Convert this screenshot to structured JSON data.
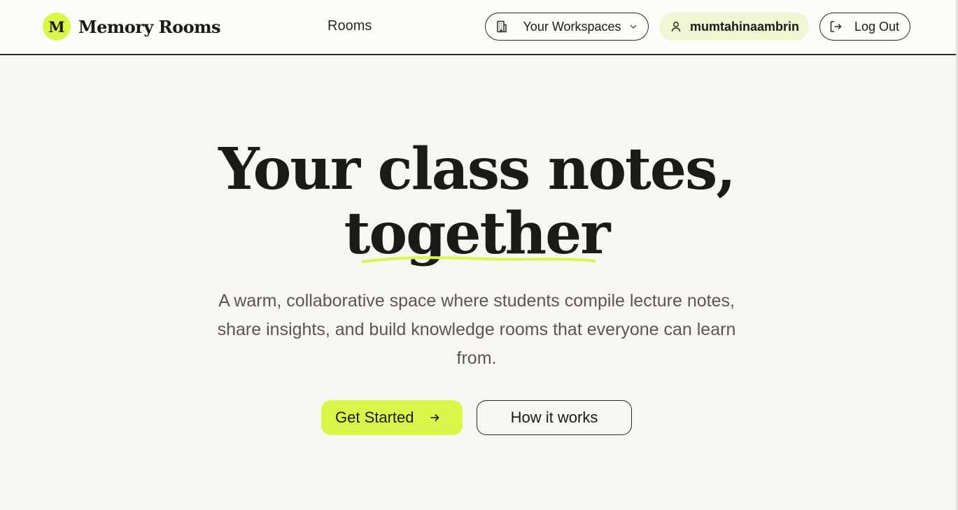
{
  "header": {
    "logo_letter": "M",
    "logo_text": "Memory Rooms",
    "nav_rooms": "Rooms",
    "workspaces_label": "Your Workspaces",
    "username": "mumtahinaambrin",
    "logout_label": "Log Out"
  },
  "hero": {
    "title_line1": "Your class notes,",
    "title_line2": "together",
    "subtitle": "A warm, collaborative space where students compile lecture notes, share insights, and build knowledge rooms that everyone can learn from.",
    "primary_cta": "Get Started",
    "secondary_cta": "How it works"
  },
  "icons": {
    "workspaces": "building-icon",
    "workspaces_dropdown": "chevron-down-icon",
    "user": "user-icon",
    "logout": "logout-icon",
    "cta_arrow": "arrow-right-icon"
  },
  "colors": {
    "accent": "#d9f64a",
    "background": "#f8f6f0",
    "header_background": "#fcfbf7",
    "text": "#1c1a17",
    "muted_text": "#5a5650",
    "user_pill": "#f0f5d4"
  }
}
